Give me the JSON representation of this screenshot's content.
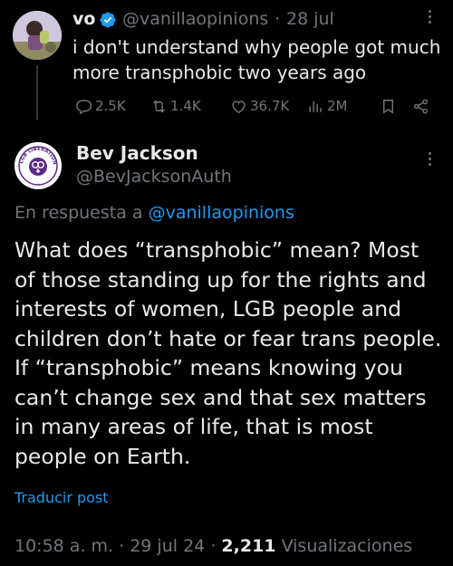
{
  "parent_tweet": {
    "display_name": "vo",
    "handle": "@vanillaopinions",
    "separator": "·",
    "date": "28 jul",
    "text": "i don't understand why people got much more transphobic two years ago",
    "stats": {
      "replies": "2.5K",
      "retweets": "1.4K",
      "likes": "36.7K",
      "views": "2M"
    },
    "icons": {
      "verified": "verified-badge-icon",
      "reply": "reply-icon",
      "retweet": "retweet-icon",
      "like": "heart-icon",
      "views": "views-chart-icon",
      "bookmark": "bookmark-icon",
      "share": "share-icon",
      "more": "more-vertical-icon"
    }
  },
  "main_tweet": {
    "display_name": "Bev Jackson",
    "handle": "@BevJacksonAuth",
    "reply_prefix": "En respuesta a",
    "reply_mention": "@vanillaopinions",
    "text": "What does “transphobic” mean? Most of those standing up for the rights and interests of women, LGB people and children don’t hate or fear trans people. If “transphobic” means knowing you can’t change sex and that sex matters in many areas of life, that is most people on Earth.",
    "translate_label": "Traducir post",
    "time": "10:58 a. m.",
    "separator": "·",
    "date": "29 jul 24",
    "separator2": "·",
    "view_count": "2,211",
    "views_label": "Visualizaciones",
    "avatar_text": "LGB LIBERATION FRONT"
  },
  "colors": {
    "background": "#000000",
    "text_primary": "#e7e9ea",
    "text_secondary": "#71767b",
    "accent": "#1d9bf0",
    "avatar_logo": "#5b2a86"
  }
}
